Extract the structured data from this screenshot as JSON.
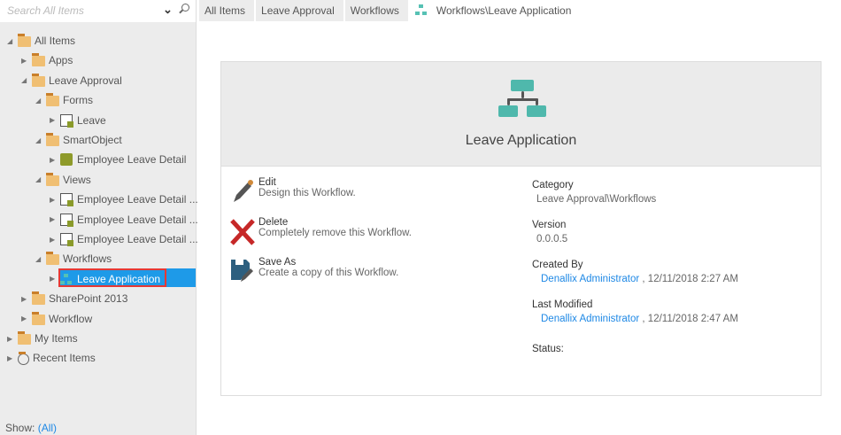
{
  "search": {
    "placeholder": "Search All Items"
  },
  "tree": [
    {
      "label": "All Items",
      "level": 0,
      "open": true,
      "icon": "all-items"
    },
    {
      "label": "Apps",
      "level": 1,
      "open": false,
      "icon": "folder"
    },
    {
      "label": "Leave Approval",
      "level": 1,
      "open": true,
      "icon": "folder"
    },
    {
      "label": "Forms",
      "level": 2,
      "open": true,
      "icon": "folder"
    },
    {
      "label": "Leave",
      "level": 3,
      "open": false,
      "icon": "form"
    },
    {
      "label": "SmartObject",
      "level": 2,
      "open": true,
      "icon": "folder"
    },
    {
      "label": "Employee Leave Detail",
      "level": 3,
      "open": false,
      "icon": "smartobject"
    },
    {
      "label": "Views",
      "level": 2,
      "open": true,
      "icon": "folder"
    },
    {
      "label": "Employee Leave Detail ...",
      "level": 3,
      "open": false,
      "icon": "view"
    },
    {
      "label": "Employee Leave Detail ...",
      "level": 3,
      "open": false,
      "icon": "view"
    },
    {
      "label": "Employee Leave Detail ...",
      "level": 3,
      "open": false,
      "icon": "view"
    },
    {
      "label": "Workflows",
      "level": 2,
      "open": true,
      "icon": "folder"
    },
    {
      "label": "Leave Application",
      "level": 3,
      "open": false,
      "icon": "workflow",
      "selected": true
    },
    {
      "label": "SharePoint 2013",
      "level": 1,
      "open": false,
      "icon": "folder"
    },
    {
      "label": "Workflow",
      "level": 1,
      "open": false,
      "icon": "folder"
    },
    {
      "label": "My Items",
      "level": 0,
      "open": false,
      "icon": "my-items"
    },
    {
      "label": "Recent Items",
      "level": 0,
      "open": false,
      "icon": "recent"
    }
  ],
  "show": {
    "label": "Show:",
    "value": "(All)"
  },
  "breadcrumb": [
    "All Items",
    "Leave Approval",
    "Workflows",
    "Workflows\\Leave Application"
  ],
  "card": {
    "title": "Leave Application",
    "actions": [
      {
        "title": "Edit",
        "desc": "Design this Workflow."
      },
      {
        "title": "Delete",
        "desc": "Completely remove this Workflow."
      },
      {
        "title": "Save As",
        "desc": "Create a copy of this Workflow."
      }
    ],
    "properties": {
      "category_label": "Category",
      "category": "Leave Approval\\Workflows",
      "version_label": "Version",
      "version": "0.0.0.5",
      "created_label": "Created By",
      "created_user": "Denallix Administrator",
      "created_date": ", 12/11/2018 2:27 AM",
      "modified_label": "Last Modified",
      "modified_user": "Denallix Administrator",
      "modified_date": ", 12/11/2018 2:47 AM",
      "status_label": "Status:"
    }
  },
  "colors": {
    "accent": "#1e9ae8",
    "selection_border": "#e53935",
    "workflow": "#4fb8ac",
    "delete": "#c62828"
  }
}
